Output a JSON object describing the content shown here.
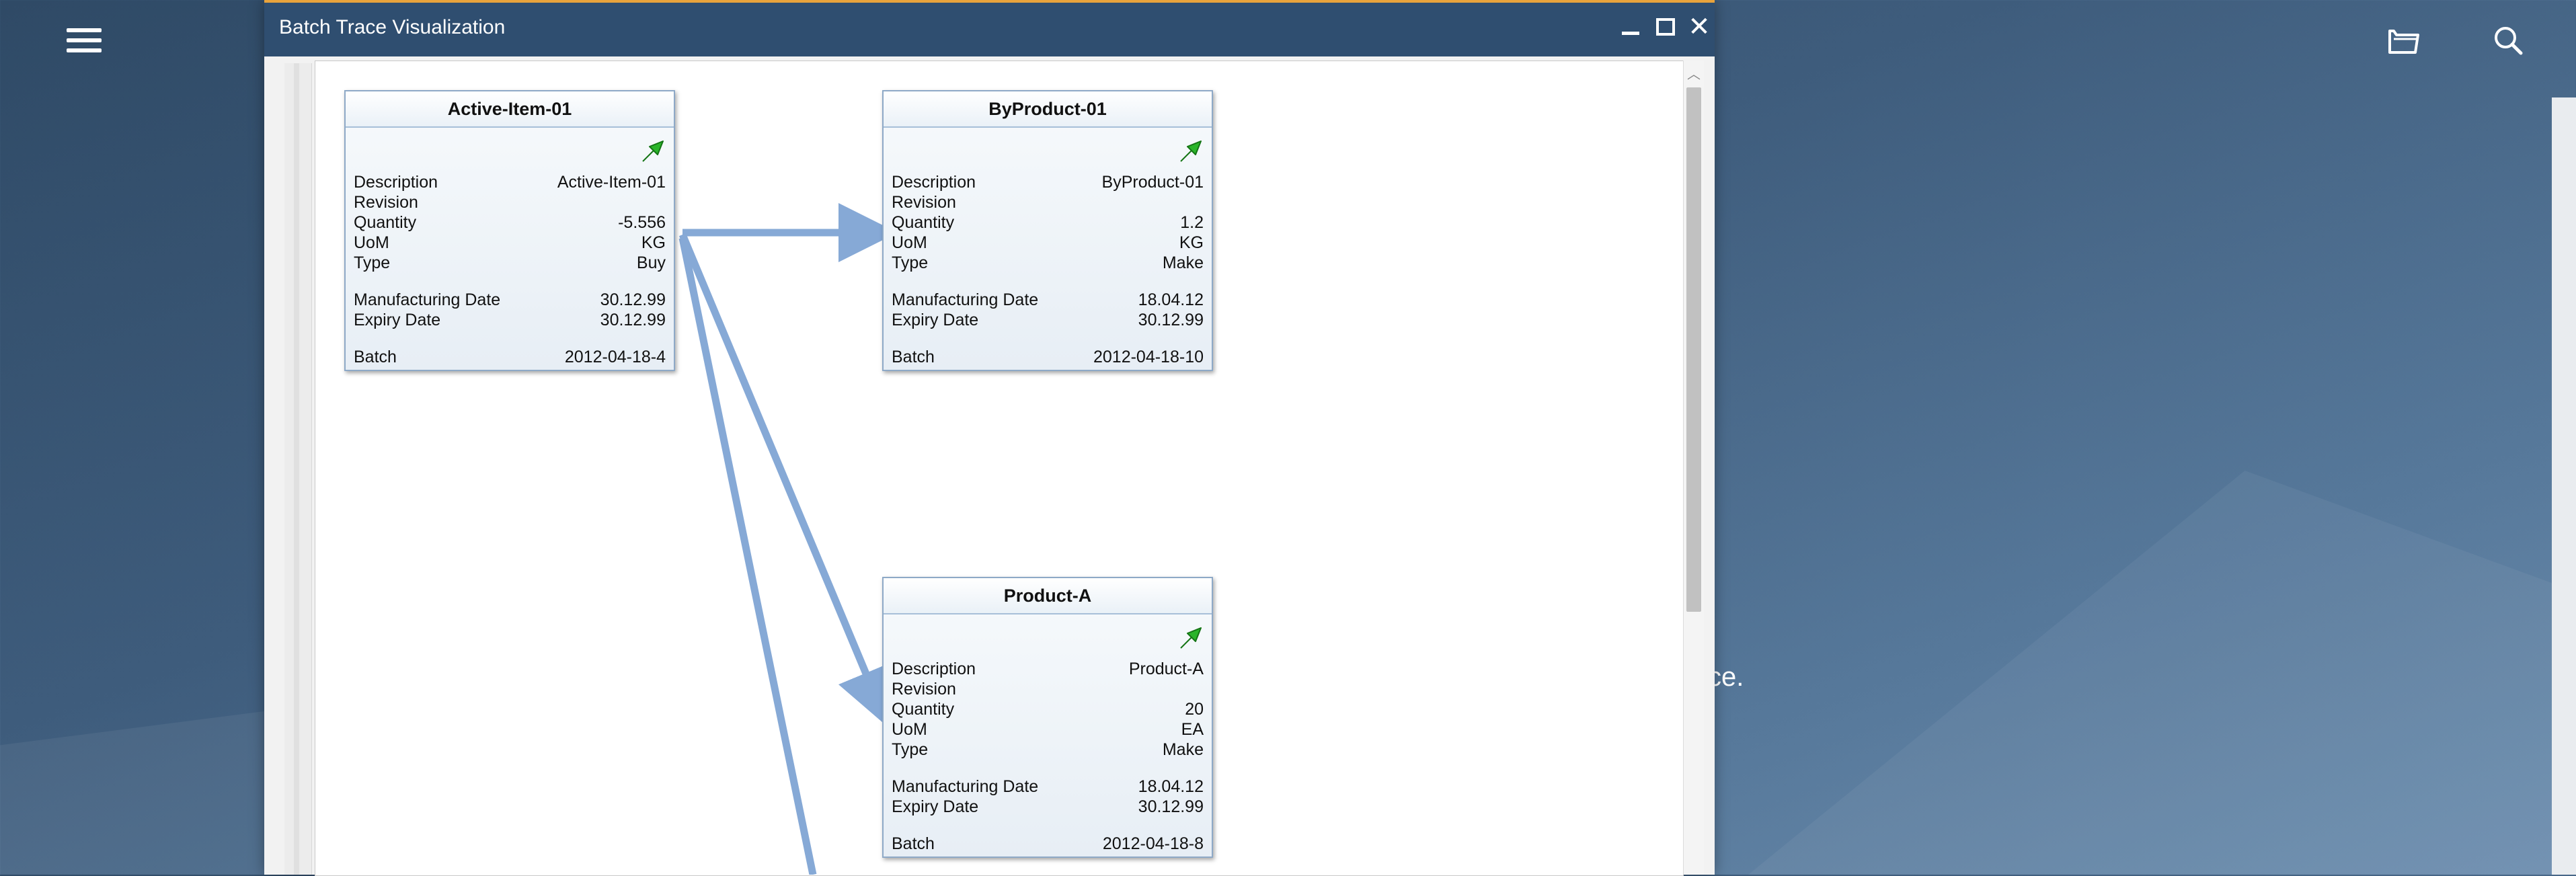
{
  "window": {
    "title": "Batch Trace Visualization"
  },
  "background": {
    "partial_text": "ce."
  },
  "labels": {
    "description": "Description",
    "revision": "Revision",
    "quantity": "Quantity",
    "uom": "UoM",
    "type": "Type",
    "mfg_date": "Manufacturing Date",
    "expiry_date": "Expiry Date",
    "batch": "Batch"
  },
  "nodes": [
    {
      "title": "Active-Item-01",
      "description": "Active-Item-01",
      "revision": "",
      "quantity": "-5.556",
      "uom": "KG",
      "type": "Buy",
      "mfg_date": "30.12.99",
      "expiry_date": "30.12.99",
      "batch": "2012-04-18-4"
    },
    {
      "title": "ByProduct-01",
      "description": "ByProduct-01",
      "revision": "",
      "quantity": "1.2",
      "uom": "KG",
      "type": "Make",
      "mfg_date": "18.04.12",
      "expiry_date": "30.12.99",
      "batch": "2012-04-18-10"
    },
    {
      "title": "Product-A",
      "description": "Product-A",
      "revision": "",
      "quantity": "20",
      "uom": "EA",
      "type": "Make",
      "mfg_date": "18.04.12",
      "expiry_date": "30.12.99",
      "batch": "2012-04-18-8"
    }
  ],
  "icons": {
    "menu": "hamburger-menu-icon",
    "open": "open-folder-icon",
    "search": "search-icon",
    "node_link": "green-arrow-icon"
  },
  "colors": {
    "titlebar": "#2f4e70",
    "link": "#86a9d6",
    "arrow_green": "#2ab52a"
  }
}
